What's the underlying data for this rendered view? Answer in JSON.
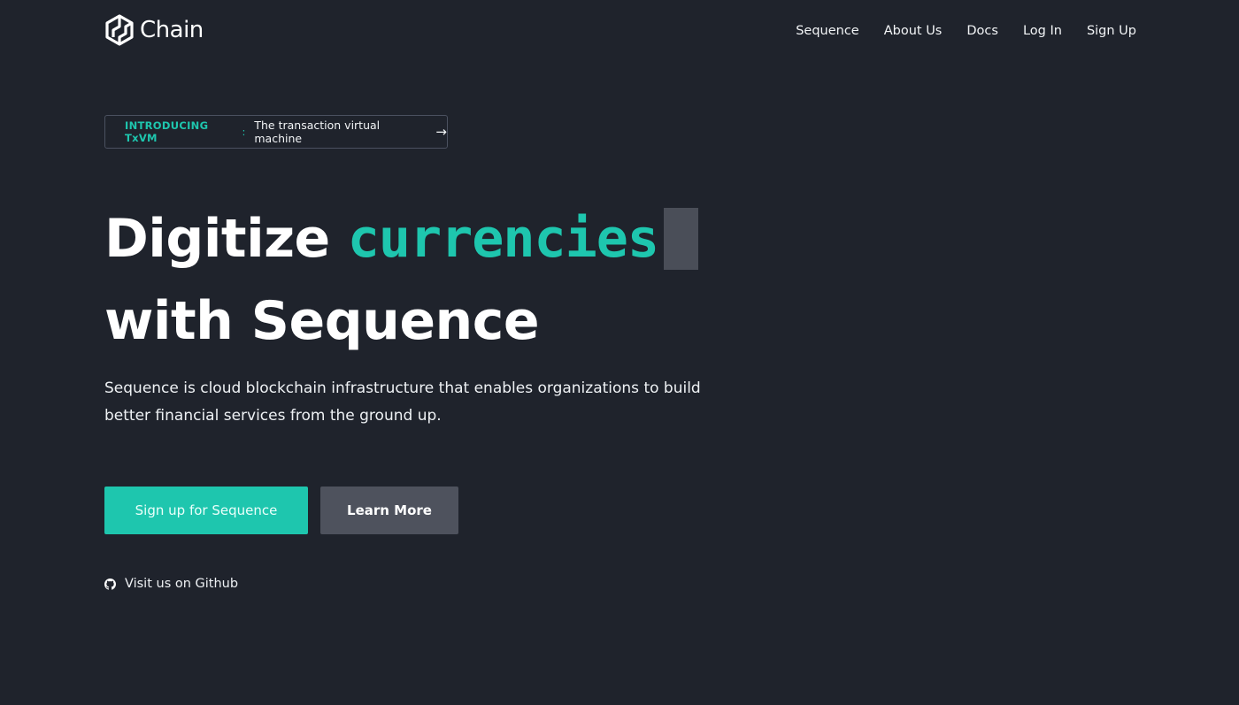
{
  "header": {
    "logo_text": "Chain",
    "nav": [
      {
        "label": "Sequence"
      },
      {
        "label": "About Us"
      },
      {
        "label": "Docs"
      },
      {
        "label": "Log In"
      },
      {
        "label": "Sign Up"
      }
    ]
  },
  "intro": {
    "tag": "INTRODUCING TxVM",
    "colon": ":",
    "text": "The transaction virtual machine",
    "arrow": "→"
  },
  "hero": {
    "title_part1": "Digitize",
    "title_highlight": "currencies",
    "title_line2": "with Sequence",
    "description": "Sequence is cloud blockchain infrastructure that enables organizations to build better financial services from the ground up."
  },
  "actions": {
    "primary_label": "Sign up for Sequence",
    "secondary_label": "Learn More"
  },
  "github": {
    "label": "Visit us on Github",
    "icon": "github-icon"
  },
  "colors": {
    "background": "#1f232c",
    "accent": "#1ec6ae",
    "secondary_button": "#4e525d",
    "cursor_block": "#4a4e58",
    "pill_border": "#4b5160"
  }
}
